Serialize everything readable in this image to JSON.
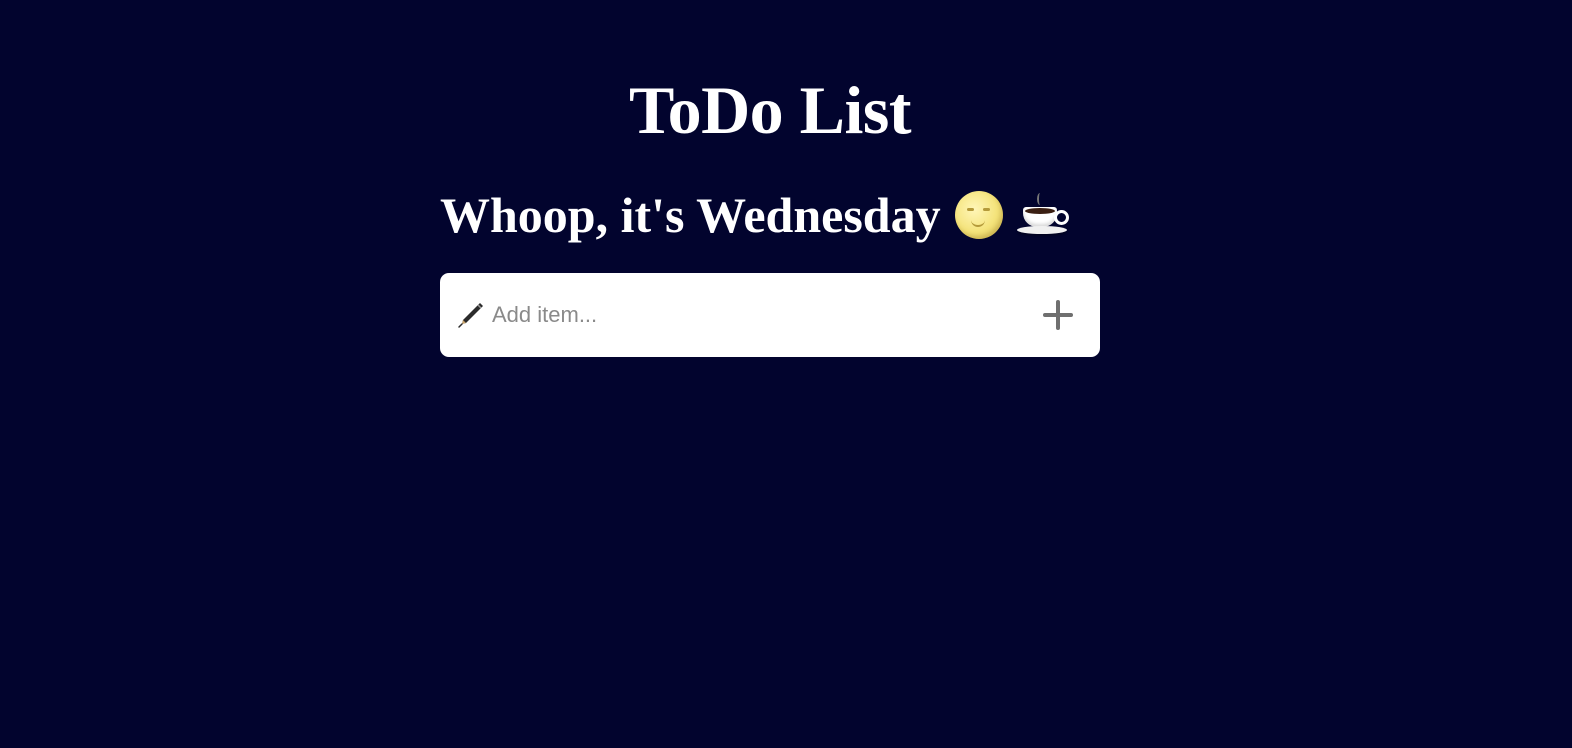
{
  "app": {
    "title": "ToDo List"
  },
  "greeting": {
    "text": "Whoop, it's Wednesday",
    "emojis": [
      "moon-face-icon",
      "coffee-icon"
    ]
  },
  "add_item": {
    "placeholder": "Add item...",
    "value": "",
    "leading_icon": "pen-icon",
    "button_icon": "plus-icon"
  },
  "colors": {
    "background": "#02042e",
    "text": "#ffffff",
    "input_background": "#ffffff",
    "placeholder": "#8a8a8a",
    "plus": "#6f6f6f"
  }
}
